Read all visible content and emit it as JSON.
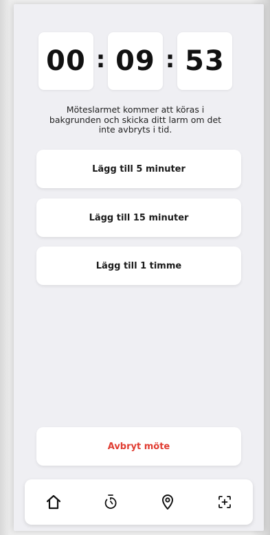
{
  "timer": {
    "hours": "00",
    "minutes": "09",
    "seconds": "53",
    "separator": ":"
  },
  "info": {
    "text": "Möteslarmet kommer att köras i bakgrunden och skicka ditt larm om det inte avbryts i tid."
  },
  "actions": {
    "add_5": "Lägg till 5 minuter",
    "add_15": "Lägg till 15 minuter",
    "add_60": "Lägg till 1 timme",
    "cancel": "Avbryt möte"
  },
  "colors": {
    "cancel_text": "#e03c31",
    "background": "#efeff3",
    "card": "#ffffff"
  },
  "nav": {
    "items": [
      {
        "icon": "home-icon"
      },
      {
        "icon": "timer-icon"
      },
      {
        "icon": "location-pin-icon"
      },
      {
        "icon": "scan-add-icon"
      }
    ]
  }
}
